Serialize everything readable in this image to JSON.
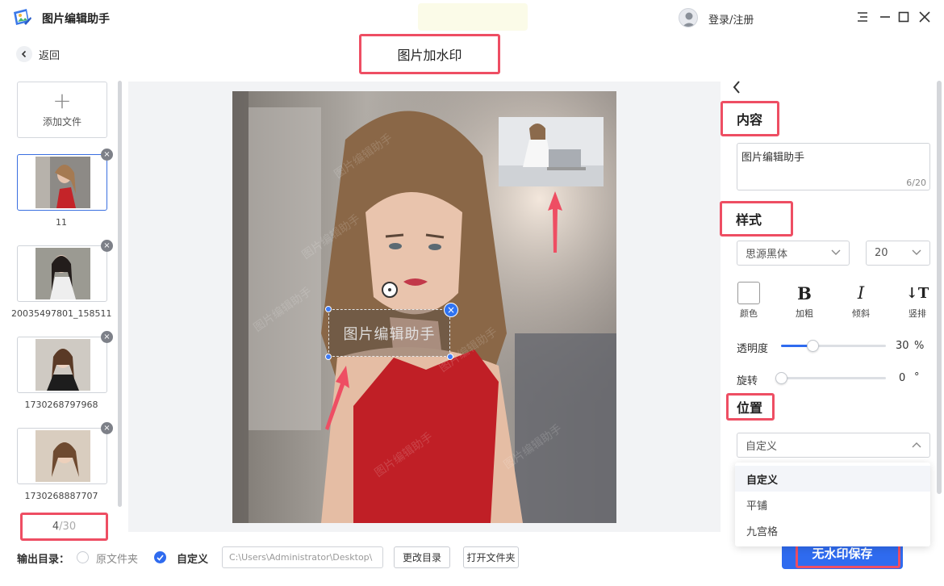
{
  "app": {
    "title": "图片编辑助手",
    "login": "登录/注册"
  },
  "nav": {
    "back": "返回",
    "page_title": "图片加水印"
  },
  "sidebar": {
    "add_file": "添加文件",
    "files": [
      {
        "name": "11",
        "active": true
      },
      {
        "name": "20035497801_158511..."
      },
      {
        "name": "1730268797968"
      },
      {
        "name": "1730268887707"
      }
    ],
    "page_current": "4",
    "page_total": "/30"
  },
  "canvas": {
    "watermark_text": "图片编辑助手"
  },
  "output": {
    "label": "输出目录：",
    "option_original": "原文件夹",
    "option_custom": "自定义",
    "path": "C:\\Users\\Administrator\\Desktop\\",
    "change_dir": "更改目录",
    "open_folder": "打开文件夹",
    "save": "无水印保存"
  },
  "panel": {
    "content_title": "内容",
    "content_value": "图片编辑助手",
    "char_count": "6/20",
    "style_title": "样式",
    "font": "思源黑体",
    "size": "20",
    "formats": [
      {
        "glyph": "",
        "label": "颜色"
      },
      {
        "glyph": "B",
        "label": "加粗"
      },
      {
        "glyph": "I",
        "label": "倾斜"
      },
      {
        "glyph": "↓T",
        "label": "竖排"
      }
    ],
    "opacity_label": "透明度",
    "opacity_value": "30",
    "opacity_unit": "%",
    "opacity_level": 0.3,
    "rotate_label": "旋转",
    "rotate_value": "0",
    "rotate_unit": "°",
    "position_title": "位置",
    "position_selected": "自定义",
    "position_options": [
      "自定义",
      "平铺",
      "九宫格"
    ]
  }
}
